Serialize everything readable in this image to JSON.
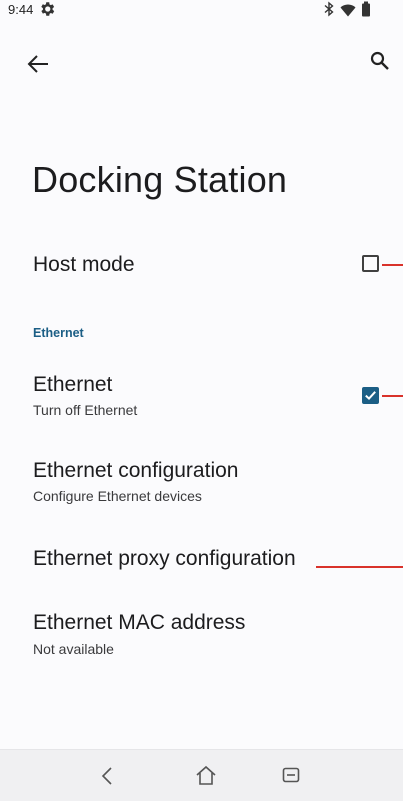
{
  "status_bar": {
    "time": "9:44",
    "icons": [
      "gear-icon",
      "bluetooth-icon",
      "wifi-icon",
      "battery-icon"
    ]
  },
  "top_bar": {
    "back_icon": "arrow-left-icon",
    "search_icon": "search-icon"
  },
  "page": {
    "title": "Docking Station"
  },
  "settings": {
    "host_mode": {
      "title": "Host mode",
      "checked": false
    },
    "ethernet_section": "Ethernet",
    "ethernet": {
      "title": "Ethernet",
      "summary": "Turn off Ethernet",
      "checked": true
    },
    "ethernet_config": {
      "title": "Ethernet configuration",
      "summary": "Configure Ethernet devices"
    },
    "ethernet_proxy": {
      "title": "Ethernet proxy configuration"
    },
    "ethernet_mac": {
      "title": "Ethernet MAC address",
      "summary": "Not available"
    }
  },
  "nav_bar": {
    "icons": [
      "back-nav-icon",
      "home-icon",
      "recents-icon"
    ]
  },
  "colors": {
    "accent": "#1b5e85",
    "callout": "#d9322b",
    "background": "#fbfbfd"
  }
}
